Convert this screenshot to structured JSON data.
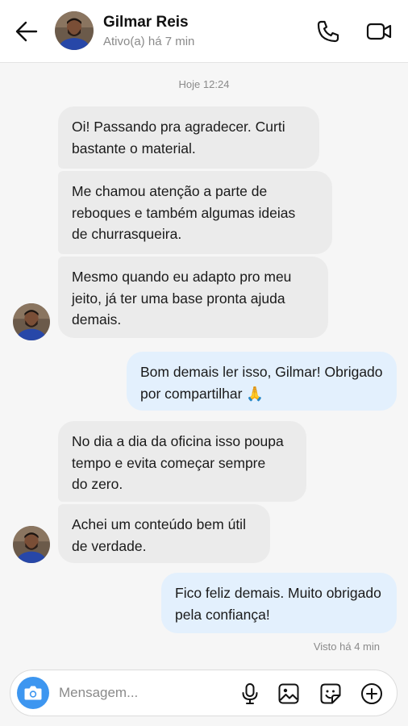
{
  "header": {
    "contact_name": "Gilmar Reis",
    "status": "Ativo(a) há 7 min"
  },
  "chat": {
    "date_label": "Hoje 12:24",
    "messages": [
      {
        "direction": "in",
        "text": "Oi! Passando pra agradecer. Curti\nbastante o material."
      },
      {
        "direction": "in",
        "text": "Me chamou atenção a parte de\nreboques e também algumas ideias\nde churrasqueira."
      },
      {
        "direction": "in",
        "text": "Mesmo quando eu adapto pro meu\njeito, já ter uma base pronta ajuda\ndemais."
      },
      {
        "direction": "out",
        "text": "Bom demais ler isso, Gilmar! Obrigado\npor compartilhar 🙏"
      },
      {
        "direction": "in",
        "text": "No dia a dia da oficina isso poupa\ntempo e evita começar sempre\ndo zero."
      },
      {
        "direction": "in",
        "text": "Achei um conteúdo bem útil\nde verdade."
      },
      {
        "direction": "out",
        "text": "Fico feliz demais. Muito obrigado\npela confiança!"
      }
    ],
    "seen_label": "Visto há 4 min"
  },
  "composer": {
    "placeholder": "Mensagem..."
  },
  "colors": {
    "incoming_bubble": "#ebebeb",
    "outgoing_bubble": "#e3f0fd",
    "camera_button": "#3d96f0"
  },
  "icons": {
    "back": "arrow-left-icon",
    "call": "phone-icon",
    "video": "video-camera-icon",
    "camera": "camera-icon",
    "mic": "microphone-icon",
    "gallery": "image-icon",
    "sticker": "sticker-icon",
    "add": "plus-circle-icon"
  }
}
